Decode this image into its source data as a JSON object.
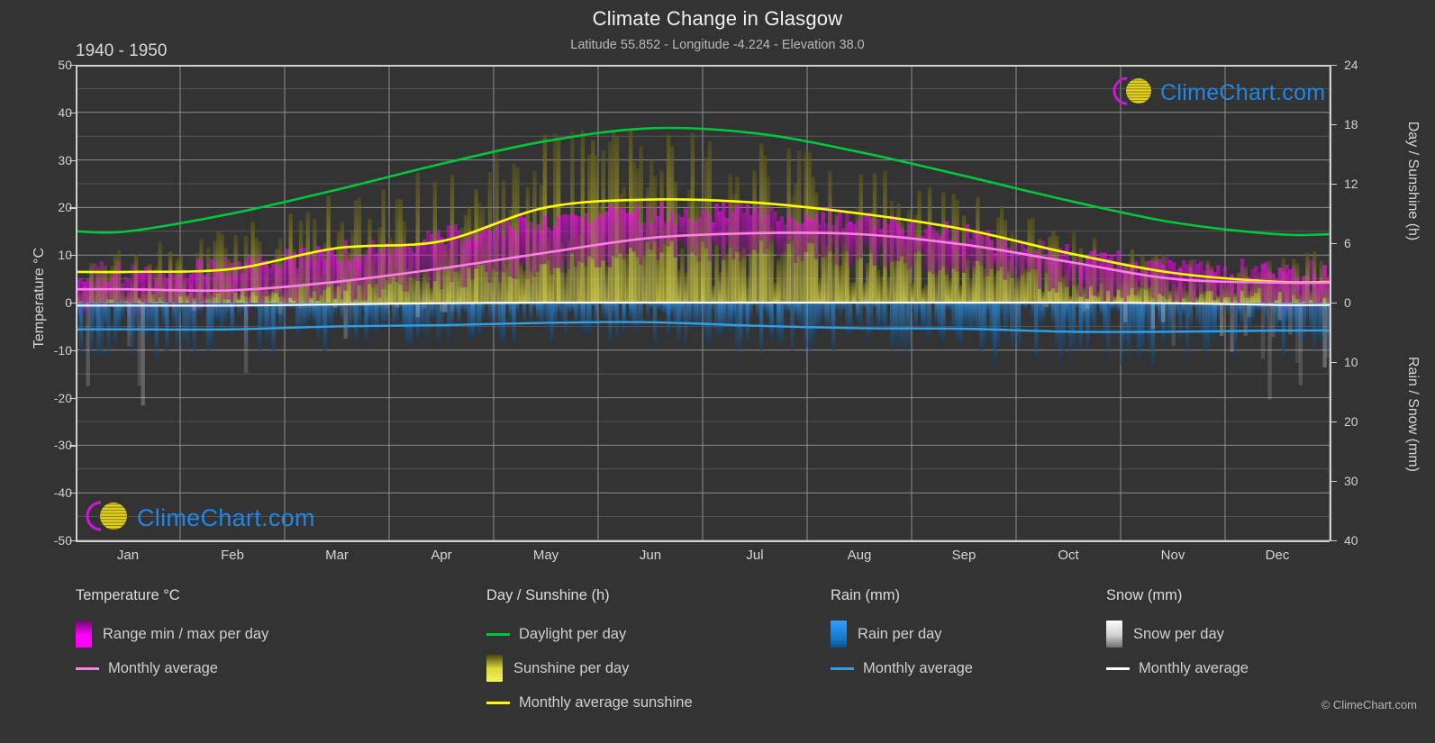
{
  "header": {
    "title": "Climate Change in Glasgow",
    "subtitle": "Latitude 55.852 - Longitude -4.224 - Elevation 38.0",
    "period": "1940 - 1950"
  },
  "brand": {
    "name": "ClimeChart.com",
    "copyright": "© ClimeChart.com"
  },
  "axes": {
    "left_title": "Temperature °C",
    "right_top_title": "Day / Sunshine (h)",
    "right_bottom_title": "Rain / Snow (mm)"
  },
  "legend": {
    "temperature": {
      "heading": "Temperature °C",
      "items": [
        {
          "label": "Range min / max per day",
          "type": "swatch",
          "color": "#ff00ff"
        },
        {
          "label": "Monthly average",
          "type": "line",
          "color": "#ff7fe8"
        }
      ]
    },
    "day_sunshine": {
      "heading": "Day / Sunshine (h)",
      "items": [
        {
          "label": "Daylight per day",
          "type": "line",
          "color": "#00c83c"
        },
        {
          "label": "Sunshine per day",
          "type": "swatch",
          "color": "#e8e84a"
        },
        {
          "label": "Monthly average sunshine",
          "type": "line",
          "color": "#ffff00"
        }
      ]
    },
    "rain": {
      "heading": "Rain (mm)",
      "items": [
        {
          "label": "Rain per day",
          "type": "swatch",
          "color": "#1e90ff"
        },
        {
          "label": "Monthly average",
          "type": "line",
          "color": "#2f9fe8"
        }
      ]
    },
    "snow": {
      "heading": "Snow (mm)",
      "items": [
        {
          "label": "Snow per day",
          "type": "swatch",
          "color": "#e8e8e8"
        },
        {
          "label": "Monthly average",
          "type": "line",
          "color": "#ffffff"
        }
      ]
    }
  },
  "chart_data": {
    "type": "line",
    "title": "Climate Change in Glasgow",
    "subtitle": "Latitude 55.852 - Longitude -4.224 - Elevation 38.0",
    "period": "1940 - 1950",
    "xlabel": "",
    "categories": [
      "Jan",
      "Feb",
      "Mar",
      "Apr",
      "May",
      "Jun",
      "Jul",
      "Aug",
      "Sep",
      "Oct",
      "Nov",
      "Dec"
    ],
    "x_tick_labels": [
      "Jan",
      "Feb",
      "Mar",
      "Apr",
      "May",
      "Jun",
      "Jul",
      "Aug",
      "Sep",
      "Oct",
      "Nov",
      "Dec"
    ],
    "axes": {
      "left": {
        "label": "Temperature °C",
        "ticks": [
          50,
          40,
          30,
          20,
          10,
          0,
          -10,
          -20,
          -30,
          -40,
          -50
        ],
        "range": [
          -50,
          50
        ]
      },
      "right_top": {
        "label": "Day / Sunshine (h)",
        "ticks": [
          24,
          18,
          12,
          6,
          0
        ],
        "range": [
          0,
          24
        ],
        "maps_to_temp": [
          0,
          50
        ]
      },
      "right_bottom": {
        "label": "Rain / Snow (mm)",
        "ticks": [
          0,
          10,
          20,
          30,
          40
        ],
        "range": [
          0,
          40
        ],
        "maps_to_temp": [
          0,
          -50
        ]
      }
    },
    "grid": true,
    "legend_position": "below",
    "series": [
      {
        "name": "Daylight per day",
        "unit": "h",
        "color": "#00c83c",
        "axis": "right_top",
        "values": [
          7.2,
          9.0,
          11.4,
          14.0,
          16.3,
          17.6,
          17.1,
          15.2,
          12.8,
          10.3,
          8.1,
          6.9
        ]
      },
      {
        "name": "Monthly average sunshine",
        "unit": "h",
        "color": "#ffff00",
        "axis": "right_top",
        "values": [
          3.1,
          3.4,
          5.5,
          6.2,
          9.6,
          10.4,
          10.1,
          9.0,
          7.4,
          5.0,
          3.0,
          2.1
        ]
      },
      {
        "name": "Temperature monthly average",
        "unit": "°C",
        "color": "#ff7fe8",
        "axis": "left",
        "values": [
          2.8,
          2.6,
          4.4,
          7.2,
          10.5,
          13.6,
          14.6,
          14.4,
          12.2,
          8.6,
          5.0,
          4.2
        ]
      },
      {
        "name": "Rain monthly average",
        "unit": "mm",
        "color": "#2f9fe8",
        "axis": "right_bottom",
        "values": [
          4.5,
          4.5,
          4.0,
          3.8,
          3.4,
          3.3,
          3.9,
          4.3,
          4.4,
          4.9,
          4.9,
          4.7
        ]
      },
      {
        "name": "Snow monthly average",
        "unit": "mm",
        "color": "#ffffff",
        "axis": "right_bottom",
        "values": [
          0.5,
          0.5,
          0.3,
          0.1,
          0.0,
          0.0,
          0.0,
          0.0,
          0.0,
          0.0,
          0.1,
          0.4
        ]
      },
      {
        "name": "Temperature range min per day",
        "unit": "°C",
        "color": "#ff00ff",
        "axis": "left",
        "values": [
          -0.4,
          -0.6,
          1.0,
          3.4,
          6.4,
          9.6,
          11.0,
          10.8,
          8.8,
          5.4,
          1.8,
          1.0
        ]
      },
      {
        "name": "Temperature range max per day",
        "unit": "°C",
        "color": "#ff00ff",
        "axis": "left",
        "values": [
          6.2,
          6.4,
          8.8,
          12.2,
          15.6,
          18.4,
          19.0,
          18.6,
          16.2,
          12.0,
          8.4,
          7.2
        ]
      },
      {
        "name": "Sunshine per day",
        "unit": "h",
        "color": "#e8e84a",
        "axis": "right_top",
        "values": [
          3.1,
          3.6,
          5.8,
          6.6,
          10.0,
          10.8,
          10.4,
          9.3,
          7.6,
          5.1,
          3.1,
          2.2
        ]
      },
      {
        "name": "Rain per day",
        "unit": "mm",
        "color": "#1e90ff",
        "axis": "right_bottom",
        "values": [
          4.6,
          4.5,
          4.0,
          3.8,
          3.4,
          3.3,
          4.0,
          4.4,
          4.5,
          5.0,
          5.0,
          4.8
        ]
      }
    ]
  }
}
